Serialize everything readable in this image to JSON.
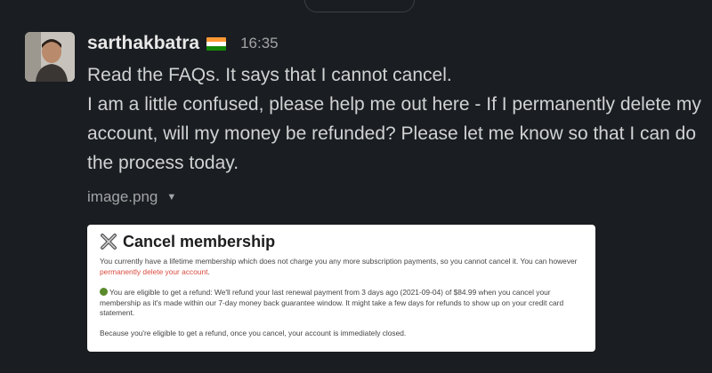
{
  "message": {
    "username": "sarthakbatra",
    "flag_icon": "india-flag-icon",
    "time": "16:35",
    "lines": [
      "Read the FAQs. It says that I cannot cancel.",
      "I am a little confused, please help me out here - If I permanently delete my account, will my money be refunded? Please let me know so that I can do the process today."
    ],
    "attachment_name": "image.png"
  },
  "card": {
    "title": "Cancel membership",
    "para1_text": "You currently have a lifetime membership which does not charge you any more subscription payments, so you cannot cancel it. You can however ",
    "para1_link": "permanently delete your account",
    "para1_end": ".",
    "para2": "You are eligible to get a refund: We'll refund your last renewal payment from 3 days ago (2021-09-04) of $84.99 when you cancel your membership as it's made within our 7-day money back guarantee window. It might take a few days for refunds to show up on your credit card statement.",
    "para3": "Because you're eligible to get a refund, once you cancel, your account is immediately closed."
  },
  "colors": {
    "background": "#1a1d21",
    "text": "#d1d2d3",
    "link": "#d94b3f"
  }
}
